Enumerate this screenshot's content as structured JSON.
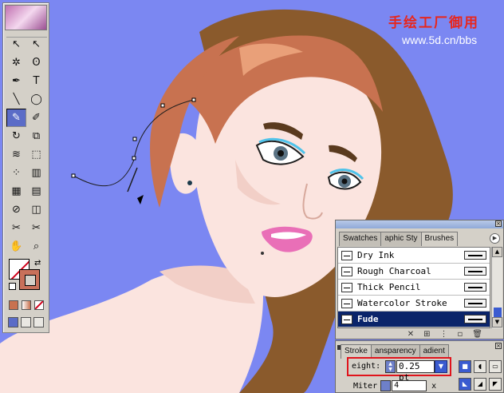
{
  "watermark": {
    "chinese_text": "手绘工厂御用",
    "url": "www.5d.cn/bbs"
  },
  "colors": {
    "background": "#7b87f2",
    "skin": "#fbe4df",
    "hair": "#8a5a2c",
    "hair_highlight": "#c87250",
    "selection_blue": "#0a246a",
    "highlight_red": "#e0141c"
  },
  "toolbox": {
    "tools": [
      {
        "name": "selection-tool",
        "glyph": "↖"
      },
      {
        "name": "direct-selection-tool",
        "glyph": "↖"
      },
      {
        "name": "magic-wand-tool",
        "glyph": "✲"
      },
      {
        "name": "lasso-tool",
        "glyph": "ʘ"
      },
      {
        "name": "pen-tool",
        "glyph": "✒"
      },
      {
        "name": "type-tool",
        "glyph": "T"
      },
      {
        "name": "line-tool",
        "glyph": "╲"
      },
      {
        "name": "ellipse-tool",
        "glyph": "◯"
      },
      {
        "name": "paintbrush-tool",
        "glyph": "✎"
      },
      {
        "name": "pencil-tool",
        "glyph": "✐"
      },
      {
        "name": "rotate-tool",
        "glyph": "↻"
      },
      {
        "name": "scale-tool",
        "glyph": "⧉"
      },
      {
        "name": "warp-tool",
        "glyph": "≋"
      },
      {
        "name": "free-transform-tool",
        "glyph": "⬚"
      },
      {
        "name": "symbol-sprayer-tool",
        "glyph": "⁘"
      },
      {
        "name": "column-graph-tool",
        "glyph": "▥"
      },
      {
        "name": "mesh-tool",
        "glyph": "▦"
      },
      {
        "name": "gradient-tool",
        "glyph": "▤"
      },
      {
        "name": "eyedropper-tool",
        "glyph": "⊘"
      },
      {
        "name": "blend-tool",
        "glyph": "◫"
      },
      {
        "name": "live-paint-bucket-tool",
        "glyph": "✂"
      },
      {
        "name": "scissors-tool",
        "glyph": "✂"
      },
      {
        "name": "hand-tool",
        "glyph": "✋"
      },
      {
        "name": "zoom-tool",
        "glyph": "⌕"
      }
    ],
    "active_tool": "paintbrush-tool"
  },
  "brushes_panel": {
    "tabs": [
      "Swatches",
      "aphic Sty",
      "Brushes"
    ],
    "active_tab": "Brushes",
    "brushes": [
      {
        "name": "Dry Ink",
        "selected": false
      },
      {
        "name": "Rough Charcoal",
        "selected": false
      },
      {
        "name": "Thick Pencil",
        "selected": false
      },
      {
        "name": "Watercolor Stroke",
        "selected": false
      },
      {
        "name": "Fude",
        "selected": true
      }
    ],
    "bottom_icons": [
      "✕",
      "⊞",
      "⋮",
      "▫",
      "🗑"
    ]
  },
  "stroke_panel": {
    "tabs": [
      "Stroke",
      "ansparency",
      "adient"
    ],
    "active_tab": "Stroke",
    "weight_label": "eight:",
    "weight_value": "0.25 pt",
    "miter_label": "Miter",
    "miter_value": "4",
    "miter_suffix": "x"
  }
}
